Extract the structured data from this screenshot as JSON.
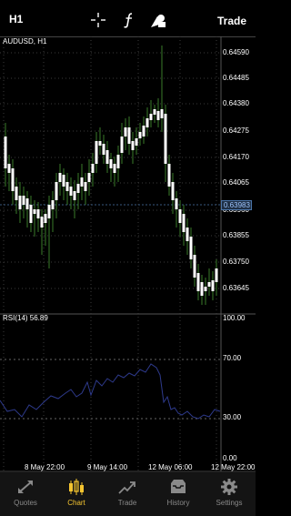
{
  "topbar": {
    "timeframe": "H1",
    "icons": [
      "crosshair-icon",
      "function-icon",
      "objects-icon"
    ],
    "trade_label": "Trade"
  },
  "chart": {
    "symbol_label": "AUDUSD, H1",
    "price_ticks": [
      "0.64590",
      "0.64485",
      "0.64380",
      "0.64275",
      "0.64170",
      "0.64065",
      "0.63960",
      "0.63855",
      "0.63750",
      "0.63645"
    ],
    "current_price": "0.63983",
    "time_ticks": [
      "8 May 22:00",
      "9 May 14:00",
      "12 May 06:00",
      "12 May 22:00"
    ],
    "colors": {
      "up": "#ffffff",
      "down": "#ffffff",
      "wick": "#3a7d2a",
      "grid": "#3a3a3a",
      "rsi_line": "#2e3a8c"
    }
  },
  "rsi": {
    "label": "RSI(14) 56.89",
    "levels": [
      "100.00",
      "70.00",
      "30.00",
      "0.00"
    ]
  },
  "tabs": [
    {
      "id": "quotes",
      "label": "Quotes",
      "icon": "quotes-icon",
      "active": false
    },
    {
      "id": "chart",
      "label": "Chart",
      "icon": "chart-icon",
      "active": true
    },
    {
      "id": "trade",
      "label": "Trade",
      "icon": "trade-icon",
      "active": false
    },
    {
      "id": "history",
      "label": "History",
      "icon": "history-icon",
      "active": false
    },
    {
      "id": "settings",
      "label": "Settings",
      "icon": "gear-icon",
      "active": false
    }
  ]
}
